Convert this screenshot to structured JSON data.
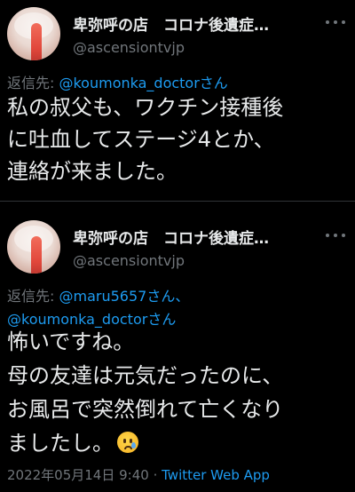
{
  "tweets": [
    {
      "author_name": "卑弥呼の店　コロナ後遺症…",
      "handle": "@ascensiontvjp",
      "reply_prefix": "返信先: ",
      "reply_mention": "@koumonka_doctor",
      "reply_suffix": "さん",
      "body": [
        "私の叔父も、ワクチン接種後",
        "に吐血してステージ4とか、",
        "連絡が来ました。"
      ]
    },
    {
      "author_name": "卑弥呼の店　コロナ後遺症…",
      "handle": "@ascensiontvjp",
      "reply_prefix": "返信先: ",
      "reply_mention_1": "@maru5657",
      "reply_mid": "さん、",
      "reply_mention_2": "@koumonka_doctor",
      "reply_suffix": "さん",
      "body": [
        "怖いですね。",
        "母の友達は元気だったのに、",
        "お風呂で突然倒れて亡くなり",
        "ましたし。"
      ],
      "emoji_icon": "crying-face-emoji",
      "timestamp": "2022年05月14日 9:40",
      "separator": " · ",
      "source": "Twitter Web App"
    }
  ],
  "colors": {
    "background": "#000000",
    "text": "#e7e9ea",
    "secondary": "#71767b",
    "link": "#1d9bf0",
    "divider": "#2f3336"
  }
}
